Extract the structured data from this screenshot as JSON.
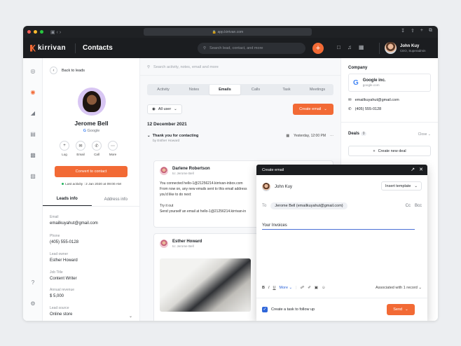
{
  "browser": {
    "url": "app.kirrivan.com"
  },
  "header": {
    "logo": "kirrivan",
    "title": "Contacts",
    "search_placeholder": "Search lead, contact, and more",
    "user": {
      "name": "John Kuy",
      "role": "CEO, Superadmin"
    }
  },
  "profile": {
    "back_label": "Back to leads",
    "name": "Jerome Bell",
    "company": "Google",
    "actions": [
      "Log",
      "Email",
      "Call",
      "More"
    ],
    "convert_label": "Convert to contact",
    "last_activity": "Last activity : 2 Jan 2020 at 09:00 AM",
    "tabs": [
      "Leads info",
      "Address info"
    ],
    "fields": [
      {
        "label": "Email",
        "value": "emailkuyahut@gmail.com"
      },
      {
        "label": "Phone",
        "value": "(405) 555-0128"
      },
      {
        "label": "Lead owner",
        "value": "Esther Howard"
      },
      {
        "label": "Job Title",
        "value": "Content Writer"
      },
      {
        "label": "Annual revenue",
        "value": "$ 5,000"
      },
      {
        "label": "Lead source",
        "value": "Online store"
      }
    ]
  },
  "center": {
    "search_placeholder": "Search activity, notes, email and more",
    "tabs": [
      "Activity",
      "Notes",
      "Emails",
      "Calls",
      "Task",
      "Meetings"
    ],
    "filter_label": "All user",
    "create_email_label": "Create email",
    "date_heading": "12 December 2021",
    "thread": {
      "title": "Thank you for contacting",
      "by": "by Esther Howard",
      "time": "Yesterday, 12:00 PM"
    },
    "email1": {
      "name": "Darlene Robertson",
      "to": "to: Jerome Bell",
      "time": "10",
      "lines": [
        "You connected hello-1@21256214.kirrivan-inbox.com",
        "From now on, any new emails sent to this email address",
        "you'd like to do next:",
        "",
        "Try it out",
        "Send yourself an email at hello-1@21256214.kirrivan-in"
      ]
    },
    "email2": {
      "name": "Esther Howard",
      "to": "to: Jerome Bell",
      "time": "10"
    }
  },
  "right": {
    "company_heading": "Company",
    "company_name": "Google inc.",
    "company_url": "google.com",
    "email": "emailkuyahut@gmail.com",
    "phone": "(405) 555-0128",
    "deals_heading": "Deals",
    "deals_count": "0",
    "close_label": "Close",
    "new_deal_label": "Create new deal"
  },
  "compose": {
    "title": "Create email",
    "from": "John Kuy",
    "insert_template": "Insert template",
    "to_label": "To",
    "to_chip": "Jerome Bell (emailkuyahut@gmail.com)",
    "cc": "Cc",
    "bcc": "Bcc",
    "subject": "Your Invoices",
    "more_label": "More",
    "associated": "Associated with 1 record",
    "task_label": "Create a task to follow up",
    "send_label": "Send"
  }
}
